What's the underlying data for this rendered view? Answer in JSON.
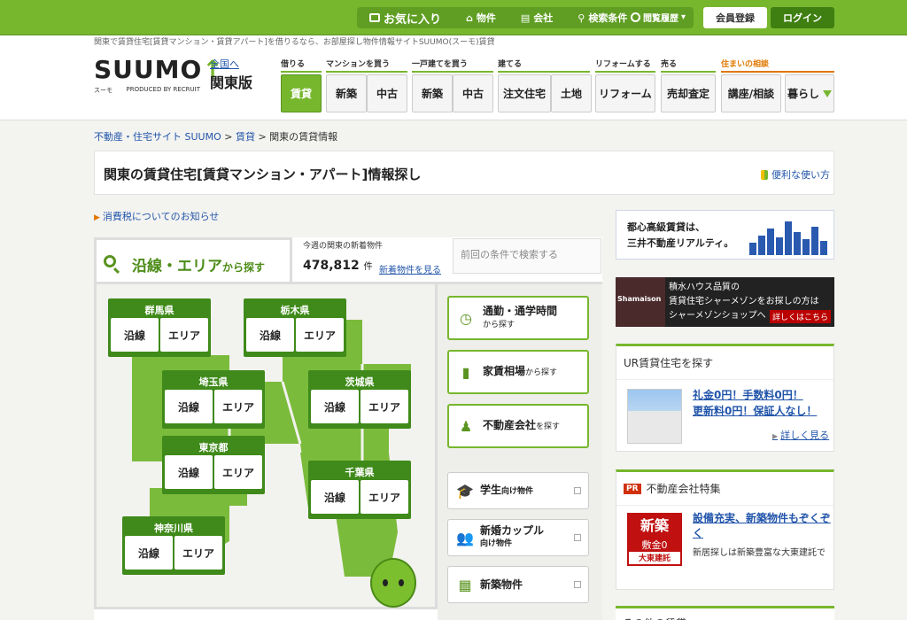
{
  "topbar": {
    "nav": [
      {
        "label": "お気に入り",
        "icon": "heart-icon"
      },
      {
        "label": "物件",
        "icon": "house-icon"
      },
      {
        "label": "会社",
        "icon": "building-icon"
      },
      {
        "label": "検索条件",
        "icon": "search-icon"
      }
    ],
    "history_label": "閲覧履歴",
    "register_label": "会員登録",
    "login_label": "ログイン"
  },
  "header": {
    "tagline": "関東で賃貸住宅[賃貸マンション・賃貸アパート]を借りるなら、お部屋探し物件情報サイトSUUMO(スーモ)賃貸",
    "logo_text": "SUUMO",
    "logo_kana": "スーモ",
    "logo_sub": "PRODUCED BY RECRUIT",
    "region_link": "全国へ",
    "region_name": "関東版",
    "categories": [
      {
        "label": "借りる"
      },
      {
        "label": "マンションを買う"
      },
      {
        "label": "一戸建てを買う"
      },
      {
        "label": "建てる"
      },
      {
        "label": "リフォームする"
      },
      {
        "label": "売る"
      },
      {
        "label": "住まいの相談"
      }
    ],
    "nav_buttons": [
      "賃貸",
      "新築",
      "中古",
      "新築",
      "中古",
      "注文住宅",
      "土地",
      "リフォーム",
      "売却査定",
      "講座/相談",
      "暮らし"
    ]
  },
  "breadcrumb": {
    "items": [
      "不動産・住宅サイト SUUMO",
      "賃貸"
    ],
    "current": "関東の賃貸情報",
    "sep": ">"
  },
  "title": {
    "heading": "関東の賃貸住宅[賃貸マンション・アパート]情報探し",
    "howto_label": "便利な使い方"
  },
  "notice": {
    "label": "消費税についてのお知らせ"
  },
  "search": {
    "tab_title": "沿線・エリア",
    "tab_suffix": "から探す",
    "new_label": "今週の関東の新着物件",
    "new_count": "478,812",
    "new_unit": "件",
    "new_link": "新着物件を見る",
    "prev_search": "前回の条件で検索する",
    "line_label": "沿線",
    "area_label": "エリア",
    "prefectures": [
      "群馬県",
      "栃木県",
      "埼玉県",
      "茨城県",
      "東京都",
      "千葉県",
      "神奈川県"
    ]
  },
  "side_search": [
    {
      "label": "通勤・通学時間",
      "sub": "から探す"
    },
    {
      "label": "家賃相場",
      "sub": "から探す"
    },
    {
      "label": "不動産会社",
      "sub": "を探す"
    }
  ],
  "features": [
    {
      "label": "学生",
      "sub": "向け物件"
    },
    {
      "label": "新婚カップル",
      "sub": "向け物件"
    },
    {
      "label": "新築物件",
      "sub": ""
    }
  ],
  "ads": {
    "mitsui_line1": "都心高級賃貸は、",
    "mitsui_line2": "三井不動産リアルティ。",
    "sekisui_line1": "積水ハウス品質の",
    "sekisui_line2": "賃貸住宅シャーメゾンをお探しの方は",
    "sekisui_line3": "シャーメゾンショップへ",
    "sekisui_more": "詳しくはこちら",
    "sekisui_img_text": "Shamaison"
  },
  "ur_card": {
    "title": "UR賃貸住宅を探す",
    "link_line1": "礼金0円！手数料0円！",
    "link_line2": "更新料0円！保証人なし！",
    "more": "詳しく見る"
  },
  "feature_card": {
    "badge": "PR",
    "title": "不動産会社特集",
    "img_line1": "新築",
    "img_line2": "敷金0",
    "img_line3": "大東建託",
    "link": "設備充実、新築物件もぞくぞく",
    "desc": "新居探しは新築豊富な大東建託で"
  },
  "bottom_card": {
    "title": "その他の賃貸"
  }
}
